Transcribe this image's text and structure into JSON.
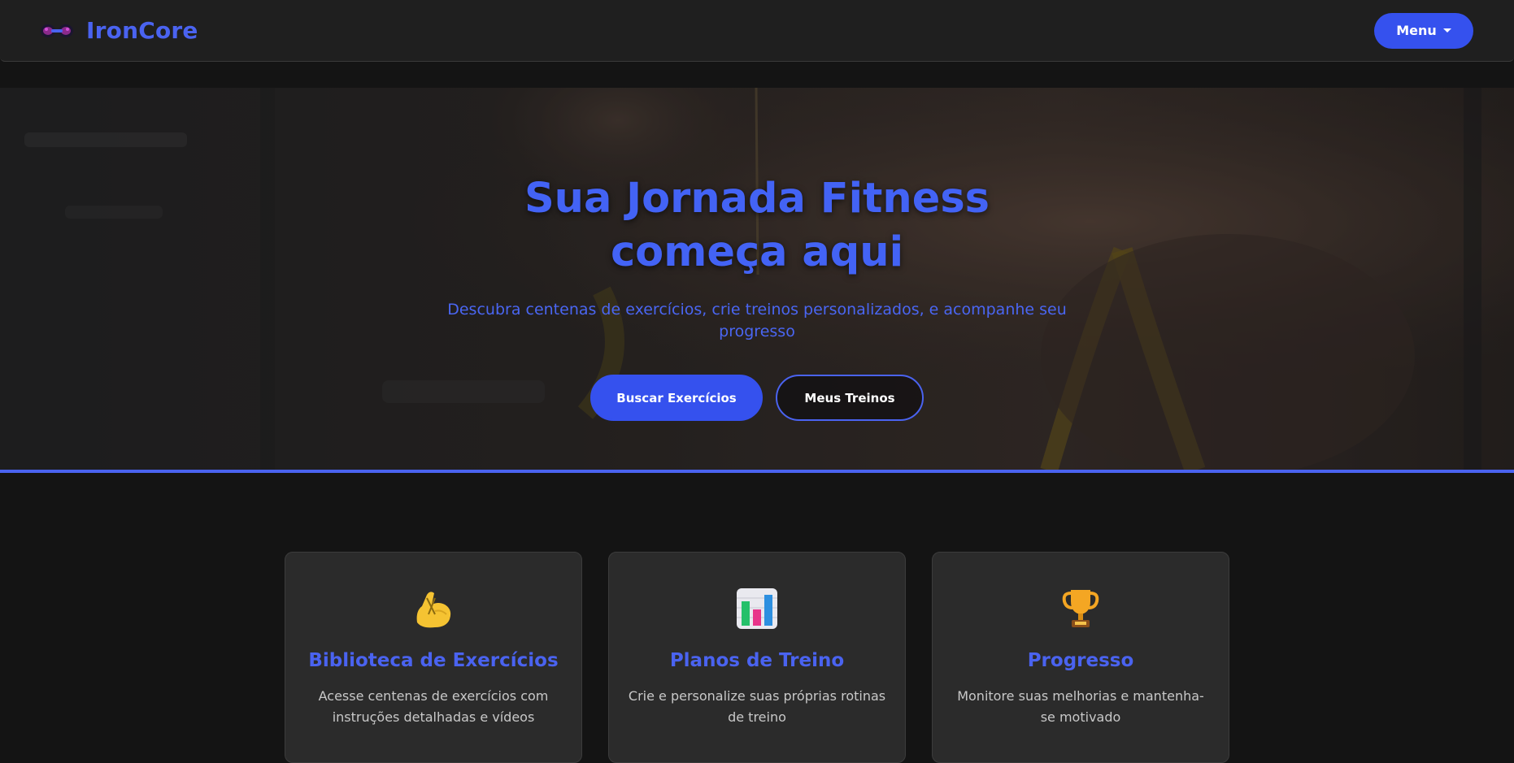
{
  "navbar": {
    "brand_name": "IronCore",
    "logo_icon": "dumbbell-icon",
    "menu_label": "Menu"
  },
  "hero": {
    "title": "Sua Jornada Fitness começa aqui",
    "subtitle": "Descubra centenas de exercícios, crie treinos personalizados, e acompanhe seu progresso",
    "primary_button": "Buscar Exercícios",
    "secondary_button": "Meus Treinos"
  },
  "features": [
    {
      "icon": "flexed-biceps-icon",
      "title": "Biblioteca de Exercícios",
      "text": "Acesse centenas de exercícios com instruções detalhadas e vídeos"
    },
    {
      "icon": "bar-chart-icon",
      "title": "Planos de Treino",
      "text": "Crie e personalize suas próprias rotinas de treino"
    },
    {
      "icon": "trophy-icon",
      "title": "Progresso",
      "text": "Monitore suas melhorias e mantenha-se motivado"
    }
  ],
  "colors": {
    "accent": "#4a63f0",
    "button": "#3551ee",
    "background": "#141414",
    "card": "#2b2b2b"
  }
}
